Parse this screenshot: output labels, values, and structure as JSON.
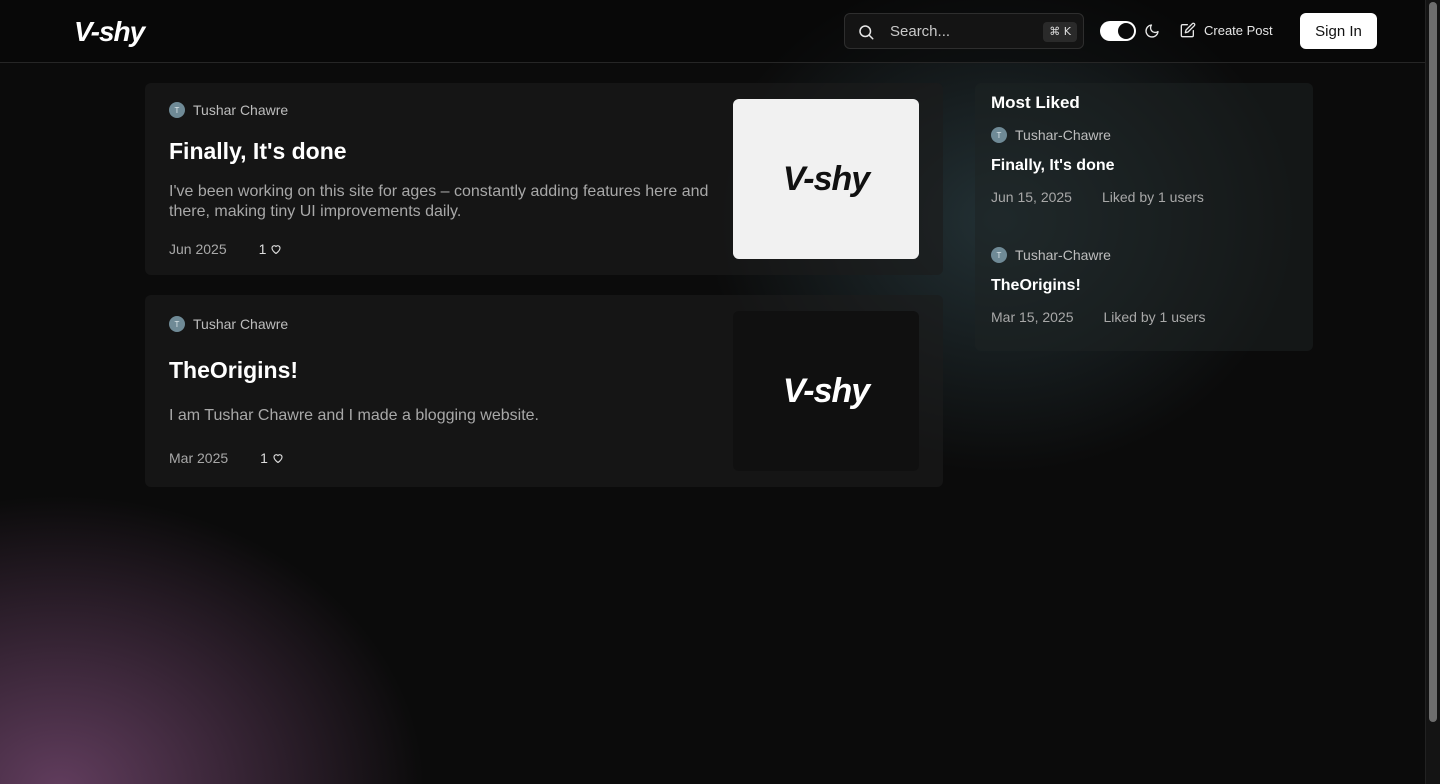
{
  "header": {
    "logo": "V-shy",
    "search_placeholder": "Search...",
    "search_shortcut": "⌘ K",
    "create_post_label": "Create Post",
    "sign_in_label": "Sign In"
  },
  "posts": [
    {
      "author": "Tushar Chawre",
      "avatar_initial": "T",
      "title": "Finally, It's done",
      "excerpt": "I've been working on this site for ages – constantly adding features here and there, making tiny UI improvements daily.",
      "date": "Jun 2025",
      "likes": "1",
      "thumbnail_text": "V-shy",
      "thumbnail_theme": "light"
    },
    {
      "author": "Tushar Chawre",
      "avatar_initial": "T",
      "title": "TheOrigins!",
      "excerpt": "I am Tushar Chawre and I made a blogging website.",
      "date": "Mar 2025",
      "likes": "1",
      "thumbnail_text": "V-shy",
      "thumbnail_theme": "dark"
    }
  ],
  "most_liked": {
    "title": "Most Liked",
    "items": [
      {
        "author": "Tushar-Chawre",
        "avatar_initial": "T",
        "title": "Finally, It's done",
        "date": "Jun 15, 2025",
        "likes_text": "Liked by 1 users"
      },
      {
        "author": "Tushar-Chawre",
        "avatar_initial": "T",
        "title": "TheOrigins!",
        "date": "Mar 15, 2025",
        "likes_text": "Liked by 1 users"
      }
    ]
  },
  "colors": {
    "background": "#0b0b0b",
    "accent_button": "#ffffff",
    "avatar": "#6f8a96",
    "glow_teal": "#466973",
    "glow_purple": "#82507d"
  },
  "icons": [
    "search-icon",
    "moon-icon",
    "edit-icon",
    "heart-icon"
  ]
}
